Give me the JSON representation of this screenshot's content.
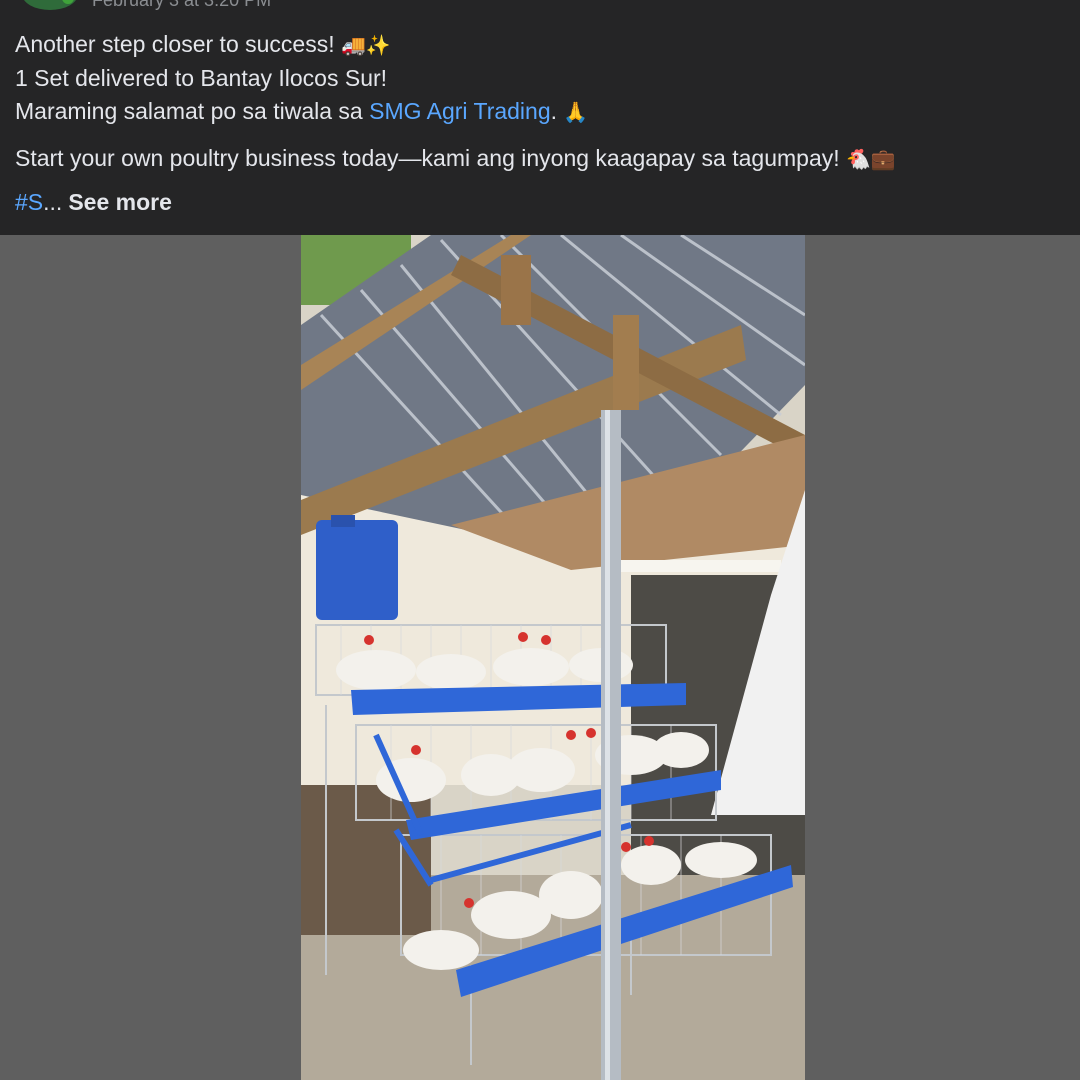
{
  "post": {
    "meta_cut": "February 3 at 3:20 PM",
    "lines": [
      {
        "text": "Another step closer to success! ",
        "emoji": "🚚✨"
      },
      {
        "text": "1 Set delivered to Bantay Ilocos Sur!"
      },
      {
        "before": "Maraming salamat po sa tiwala sa ",
        "link": "SMG Agri Trading",
        "after": ". ",
        "emoji": "🙏"
      },
      {
        "text": "Start your own poultry business today—kami ang inyong kaagapay sa tagumpay! ",
        "emoji": "🐔💼"
      }
    ],
    "hashtag_cut": "#S",
    "ellipsis": "...",
    "see_more": "See more"
  },
  "photo": {
    "subject": "layer chicken cage set under roofed shed"
  },
  "colors": {
    "header_bg": "#252526",
    "page_bg": "#5f5f5f",
    "link": "#5aa7ff",
    "text": "#e4e6eb"
  }
}
